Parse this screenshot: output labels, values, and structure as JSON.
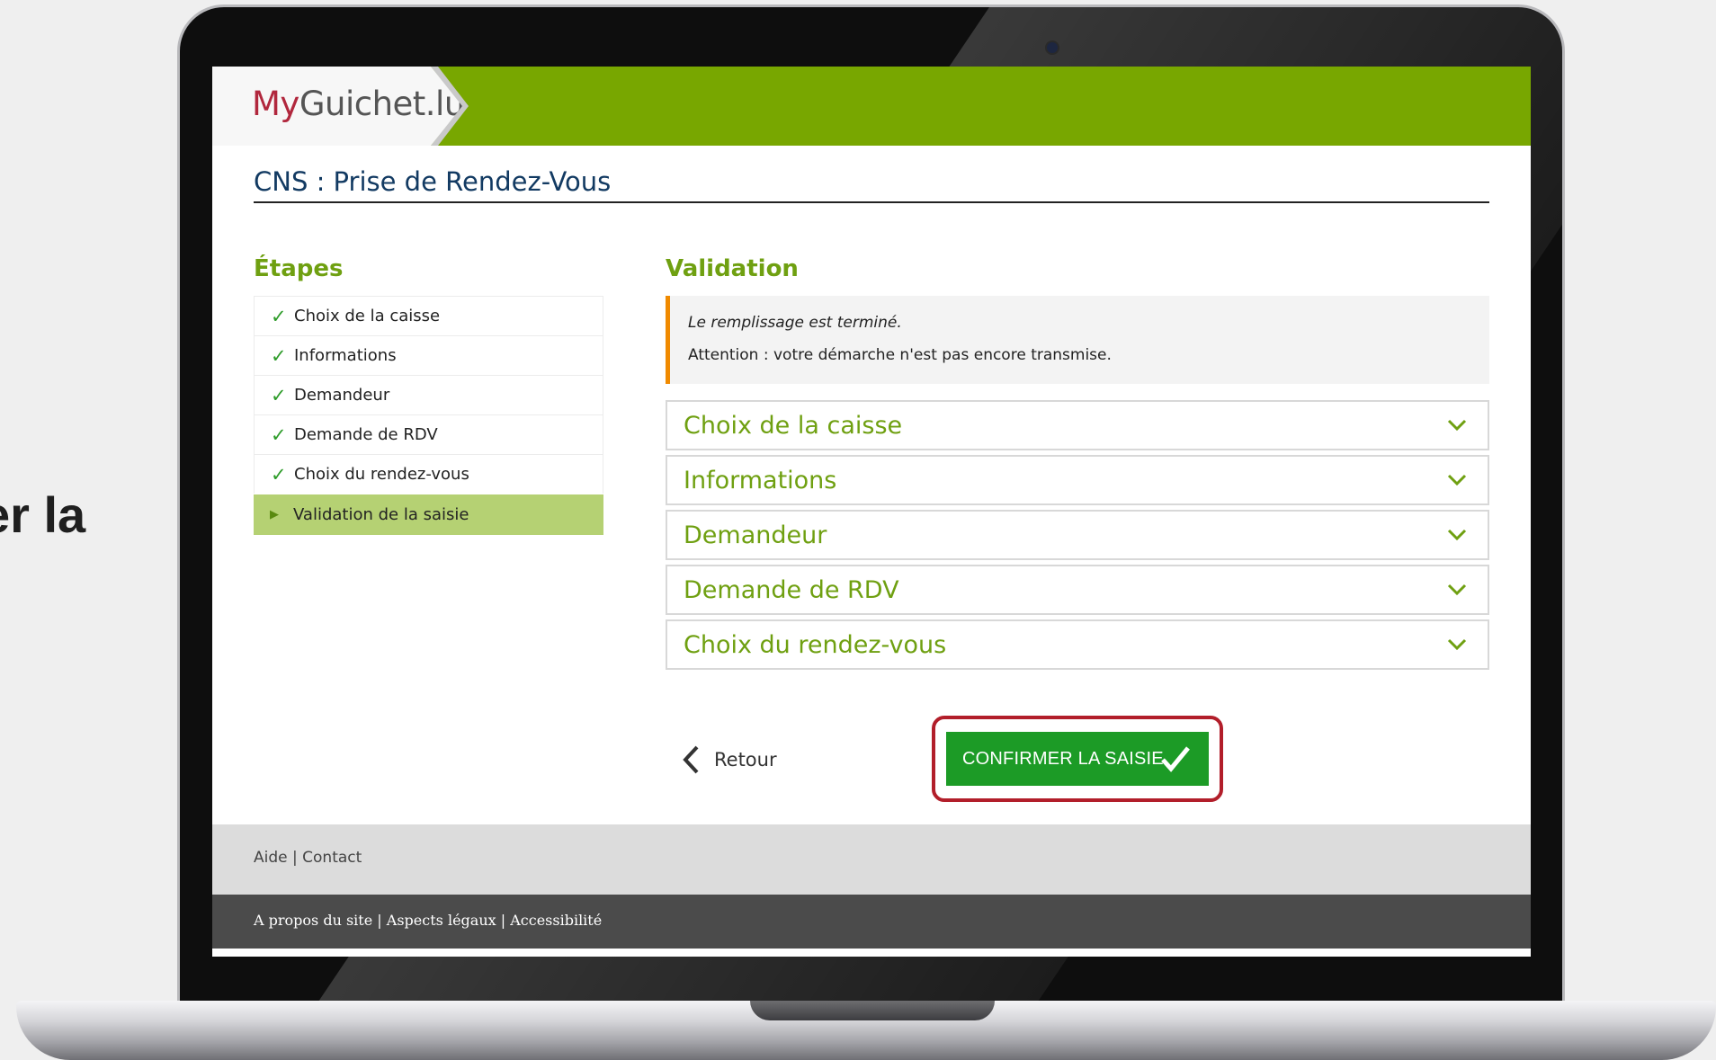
{
  "side_text": "er la",
  "brand": {
    "logo_my": "My",
    "logo_rest": "Guichet.lu"
  },
  "page_title": "CNS : Prise de Rendez-Vous",
  "steps": {
    "heading": "Étapes",
    "items": [
      {
        "label": "Choix de la caisse",
        "status": "done"
      },
      {
        "label": "Informations",
        "status": "done"
      },
      {
        "label": "Demandeur",
        "status": "done"
      },
      {
        "label": "Demande de RDV",
        "status": "done"
      },
      {
        "label": "Choix du rendez-vous",
        "status": "done"
      },
      {
        "label": "Validation de la saisie",
        "status": "current"
      }
    ]
  },
  "validation": {
    "heading": "Validation",
    "notice_line1": "Le remplissage est terminé.",
    "notice_line2": "Attention : votre démarche n'est pas encore transmise.",
    "sections": [
      {
        "label": "Choix de la caisse"
      },
      {
        "label": "Informations"
      },
      {
        "label": "Demandeur"
      },
      {
        "label": "Demande de RDV"
      },
      {
        "label": "Choix du rendez-vous"
      }
    ]
  },
  "actions": {
    "back_label": "Retour",
    "confirm_label": "CONFIRMER LA SAISIE"
  },
  "footer": {
    "help": "Aide",
    "contact": "Contact",
    "about": "A propos du site",
    "legal": "Aspects légaux",
    "accessibility": "Accessibilité",
    "separator": "|"
  },
  "colors": {
    "brand_green": "#78a700",
    "heading_green": "#6fa011",
    "confirm_green": "#1c9b26",
    "highlight_red": "#b21e2a",
    "notice_accent": "#f08a00"
  }
}
